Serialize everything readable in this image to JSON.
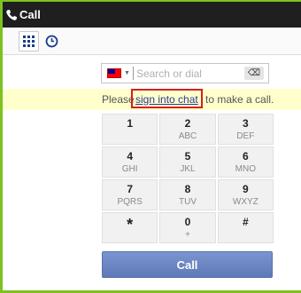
{
  "window": {
    "title": "Call"
  },
  "toolbar": {
    "dialpad_icon": "dialpad-grid-icon",
    "history_icon": "clock-icon"
  },
  "search": {
    "placeholder": "Search or dial",
    "value": "",
    "delete_label": "⌫",
    "country": "Taiwan"
  },
  "notice": {
    "pre": "Please",
    "link": "sign into chat",
    "post": "to make a call."
  },
  "keypad": [
    {
      "digit": "1",
      "letters": ""
    },
    {
      "digit": "2",
      "letters": "ABC"
    },
    {
      "digit": "3",
      "letters": "DEF"
    },
    {
      "digit": "4",
      "letters": "GHI"
    },
    {
      "digit": "5",
      "letters": "JKL"
    },
    {
      "digit": "6",
      "letters": "MNO"
    },
    {
      "digit": "7",
      "letters": "PQRS"
    },
    {
      "digit": "8",
      "letters": "TUV"
    },
    {
      "digit": "9",
      "letters": "WXYZ"
    },
    {
      "digit": "*",
      "letters": ""
    },
    {
      "digit": "0",
      "letters": "+"
    },
    {
      "digit": "#",
      "letters": ""
    }
  ],
  "call_button": {
    "label": "Call"
  },
  "colors": {
    "frame": "#7dc221",
    "titlebar": "#1f1f1f",
    "call": "#6a84c3",
    "highlight": "#d62020"
  }
}
